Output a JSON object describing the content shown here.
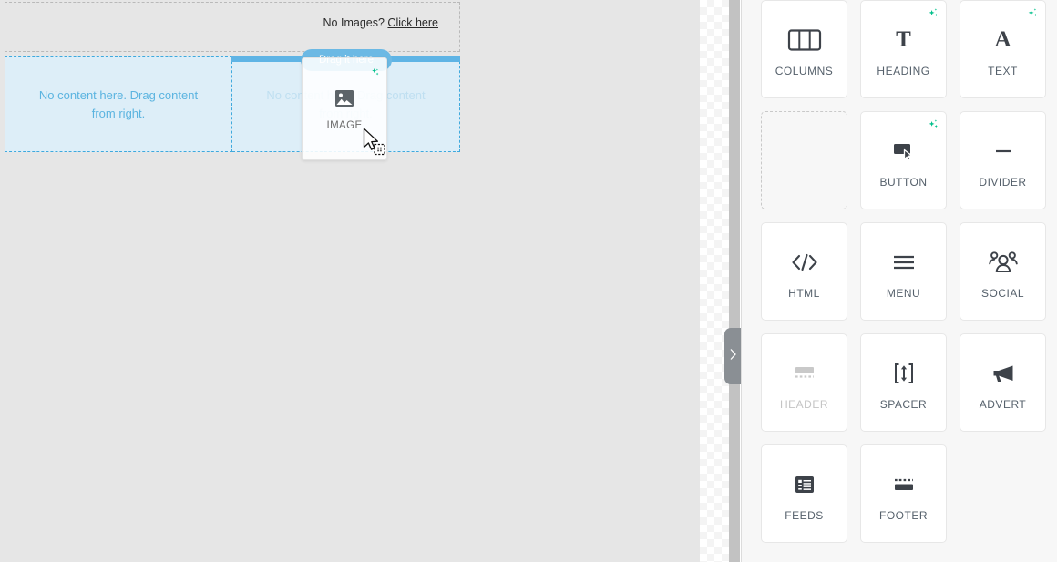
{
  "canvas": {
    "header_block": {
      "prompt_text": "No Images?",
      "link_text": "Click here"
    },
    "columns": [
      {
        "name": "left-column",
        "empty_message": "No content here. Drag content from right.",
        "state": "empty"
      },
      {
        "name": "right-column",
        "empty_message": "No content here. Drag content from right.",
        "state": "drop-active"
      }
    ],
    "drop_tooltip": "Drag it here",
    "drag_ghost": {
      "label": "IMAGE",
      "icon": "image-icon",
      "badge_icon": "ai-sparkle-icon"
    },
    "cursor": "arrow-drag-copy-cursor"
  },
  "panel": {
    "collapse_handle_icon": "chevron-right-icon",
    "widgets": [
      {
        "label": "COLUMNS",
        "icon": "columns-icon",
        "ai": false,
        "disabled": false,
        "placeholder": false
      },
      {
        "label": "HEADING",
        "icon": "heading-icon",
        "ai": true,
        "disabled": false,
        "placeholder": false
      },
      {
        "label": "TEXT",
        "icon": "text-icon",
        "ai": true,
        "disabled": false,
        "placeholder": false
      },
      {
        "label": "",
        "icon": "empty-slot",
        "ai": false,
        "disabled": false,
        "placeholder": true
      },
      {
        "label": "BUTTON",
        "icon": "button-icon",
        "ai": true,
        "disabled": false,
        "placeholder": false
      },
      {
        "label": "DIVIDER",
        "icon": "divider-icon",
        "ai": false,
        "disabled": false,
        "placeholder": false
      },
      {
        "label": "HTML",
        "icon": "html-icon",
        "ai": false,
        "disabled": false,
        "placeholder": false
      },
      {
        "label": "MENU",
        "icon": "menu-icon",
        "ai": false,
        "disabled": false,
        "placeholder": false
      },
      {
        "label": "SOCIAL",
        "icon": "social-icon",
        "ai": false,
        "disabled": false,
        "placeholder": false
      },
      {
        "label": "HEADER",
        "icon": "header-icon",
        "ai": false,
        "disabled": true,
        "placeholder": false
      },
      {
        "label": "SPACER",
        "icon": "spacer-icon",
        "ai": false,
        "disabled": false,
        "placeholder": false
      },
      {
        "label": "ADVERT",
        "icon": "advert-icon",
        "ai": false,
        "disabled": false,
        "placeholder": false
      },
      {
        "label": "FEEDS",
        "icon": "feeds-icon",
        "ai": false,
        "disabled": false,
        "placeholder": false
      },
      {
        "label": "FOOTER",
        "icon": "footer-icon",
        "ai": false,
        "disabled": false,
        "placeholder": false
      }
    ]
  },
  "colors": {
    "canvas_background": "#e6e6e6",
    "panel_background": "#f7f7f7",
    "drop_highlight": "#5fb4e5",
    "drop_fill": "#ddeef8",
    "ai_sparkle": "#00c08b",
    "label_text": "#55606b",
    "icon_dark": "#3d4249"
  }
}
